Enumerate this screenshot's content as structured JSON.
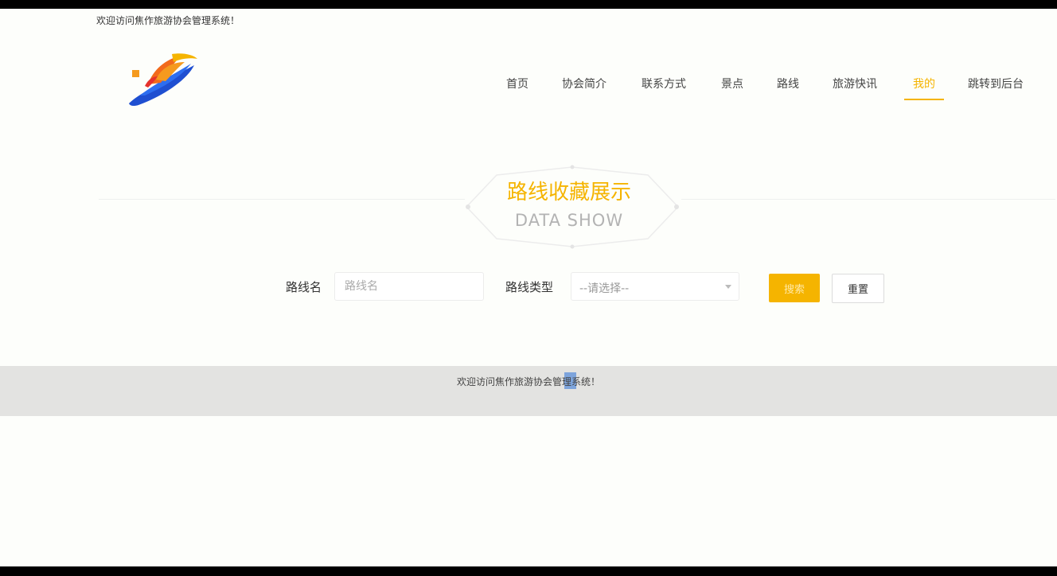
{
  "header": {
    "welcome_text": "欢迎访问焦作旅游协会管理系统！"
  },
  "nav": {
    "items": [
      {
        "label": "首页"
      },
      {
        "label": "协会简介"
      },
      {
        "label": "联系方式"
      },
      {
        "label": "景点"
      },
      {
        "label": "路线"
      },
      {
        "label": "旅游快讯"
      },
      {
        "label": "我的"
      },
      {
        "label": "跳转到后台"
      }
    ],
    "active_index": 6
  },
  "hero": {
    "title": "路线收藏展示",
    "subtitle": "DATA SHOW"
  },
  "search": {
    "name_label": "路线名",
    "name_placeholder": "路线名",
    "type_label": "路线类型",
    "type_selected": "--请选择--",
    "search_button": "搜索",
    "reset_button": "重置"
  },
  "footer": {
    "text": "欢迎访问焦作旅游协会管理系统！"
  },
  "colors": {
    "accent": "#f5b400",
    "footer_bg": "#e3e3e1",
    "page_bg": "#fdfefb"
  }
}
